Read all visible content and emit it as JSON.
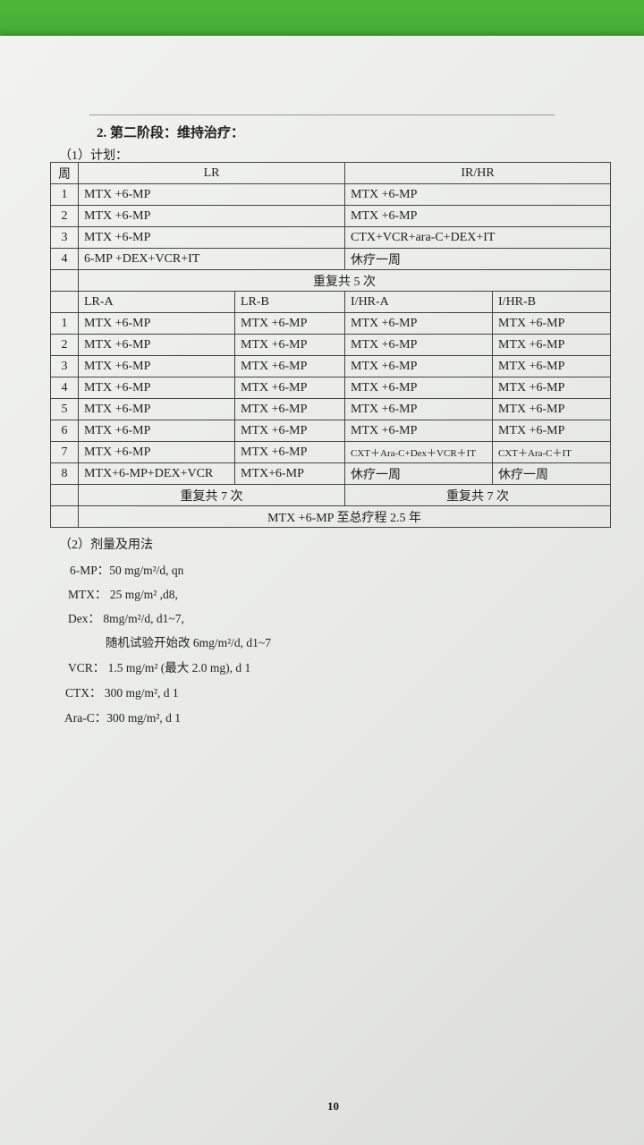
{
  "heading": "2. 第二阶段：维持治疗：",
  "plan_title": "（1）计划：",
  "table1": {
    "week_header": "周",
    "lr_header": "LR",
    "irhr_header": "IR/HR",
    "rows": [
      {
        "week": "1",
        "lr": "MTX +6-MP",
        "irhr": "MTX +6-MP"
      },
      {
        "week": "2",
        "lr": "MTX +6-MP",
        "irhr": "MTX +6-MP"
      },
      {
        "week": "3",
        "lr": "MTX +6-MP",
        "irhr": "CTX+VCR+ara-C+DEX+IT"
      },
      {
        "week": "4",
        "lr": "6-MP +DEX+VCR+IT",
        "irhr": "休疗一周"
      }
    ],
    "repeat": "重复共 5 次"
  },
  "table2": {
    "headers": [
      "LR-A",
      "LR-B",
      "I/HR-A",
      "I/HR-B"
    ],
    "rows": [
      {
        "week": "1",
        "a": "MTX +6-MP",
        "b": "MTX +6-MP",
        "c": "MTX +6-MP",
        "d": "MTX +6-MP"
      },
      {
        "week": "2",
        "a": "MTX +6-MP",
        "b": "MTX +6-MP",
        "c": "MTX +6-MP",
        "d": "MTX +6-MP"
      },
      {
        "week": "3",
        "a": "MTX +6-MP",
        "b": "MTX +6-MP",
        "c": "MTX +6-MP",
        "d": "MTX +6-MP"
      },
      {
        "week": "4",
        "a": "MTX +6-MP",
        "b": "MTX +6-MP",
        "c": "MTX +6-MP",
        "d": "MTX +6-MP"
      },
      {
        "week": "5",
        "a": "MTX +6-MP",
        "b": "MTX +6-MP",
        "c": "MTX +6-MP",
        "d": "MTX +6-MP"
      },
      {
        "week": "6",
        "a": "MTX +6-MP",
        "b": "MTX +6-MP",
        "c": "MTX +6-MP",
        "d": "MTX +6-MP"
      },
      {
        "week": "7",
        "a": "MTX +6-MP",
        "b": "MTX +6-MP",
        "c": "CXT＋Ara-C+Dex＋VCR＋IT",
        "d": "CXT＋Ara-C＋IT"
      },
      {
        "week": "8",
        "a": "MTX+6-MP+DEX+VCR",
        "b": "MTX+6-MP",
        "c": "休疗一周",
        "d": "休疗一周"
      }
    ],
    "repeat_lr": "重复共 7 次",
    "repeat_hr": "重复共 7 次",
    "final": "MTX +6-MP 至总疗程 2.5 年"
  },
  "dosage": {
    "title": "（2）剂量及用法",
    "lines": [
      "6-MP：50 mg/m²/d,    qn",
      "MTX：  25 mg/m² ,d8,",
      "Dex：    8mg/m²/d, d1~7,",
      "随机试验开始改 6mg/m²/d, d1~7",
      "VCR：  1.5 mg/m² (最大 2.0 mg), d 1",
      "CTX：   300 mg/m², d 1",
      "Ara-C：300 mg/m², d 1"
    ]
  },
  "page_number": "10"
}
